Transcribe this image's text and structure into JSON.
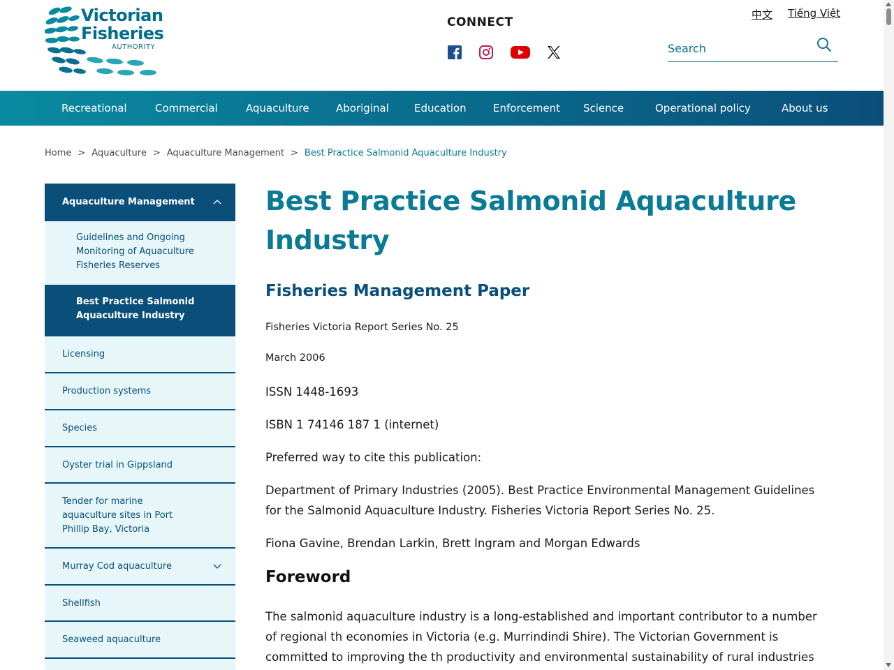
{
  "header": {
    "logo": {
      "line1": "Victorian",
      "line2": "Fisheries",
      "line3": "AUTHORITY"
    },
    "connect": {
      "title": "CONNECT",
      "icons": [
        "facebook-icon",
        "instagram-icon",
        "youtube-icon",
        "x-icon"
      ]
    },
    "languages": [
      "中文",
      "Tiếng Việt"
    ],
    "search": {
      "placeholder": "Search",
      "value": ""
    }
  },
  "nav": {
    "items": [
      "Recreational",
      "Commercial",
      "Aquaculture",
      "Aboriginal",
      "Education",
      "Enforcement",
      "Science",
      "Operational policy",
      "About us"
    ]
  },
  "breadcrumb": {
    "items": [
      "Home",
      "Aquaculture",
      "Aquaculture Management",
      "Best Practice Salmonid Aquaculture Industry"
    ],
    "separator": ">"
  },
  "sidebar": {
    "header": "Aquaculture Management",
    "sub_item": "Guidelines and Ongoing Monitoring of Aquaculture Fisheries Reserves",
    "active_item": "Best Practice Salmonid Aquaculture Industry",
    "items": [
      "Licensing",
      "Production systems",
      "Species",
      "Oyster trial in Gippsland",
      "Tender for marine aquaculture sites in Port Phillip Bay, Victoria",
      "Murray Cod aquaculture",
      "Shellfish",
      "Seaweed aquaculture"
    ]
  },
  "main": {
    "title": "Best Practice Salmonid Aquaculture Industry",
    "subtitle": "Fisheries Management Paper",
    "report_series": "Fisheries Victoria Report Series No. 25",
    "date": "March 2006",
    "issn": "ISSN 1448-1693",
    "isbn": "ISBN 1 74146 187 1 (internet)",
    "cite_label": "Preferred way to cite this publication:",
    "citation": "Department of Primary Industries (2005). Best Practice Environmental Management Guidelines for the Salmonid Aquaculture Industry. Fisheries Victoria Report Series No. 25.",
    "authors": "Fiona Gavine, Brendan Larkin, Brett Ingram and Morgan Edwards",
    "foreword_heading": "Foreword",
    "foreword_text": "The salmonid aquaculture industry is a long-established and important contributor to a number of regional th economies in Victoria (e.g. Murrindindi Shire). The Victorian Government is committed to improving the th productivity and environmental sustainability of rural industries such as the"
  },
  "colors": {
    "brand_teal": "#0a7a95",
    "brand_navy": "#0a4f7a",
    "sidebar_bg": "#e6f6f9"
  }
}
